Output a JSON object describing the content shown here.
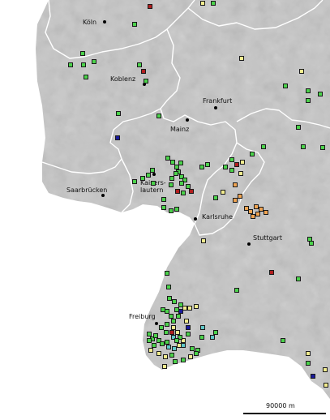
{
  "colors": {
    "land_fill": "#c9c9c9",
    "border": "#ffffff",
    "green": "#4bd24b",
    "yellow": "#f2ec8e",
    "orange": "#f0a452",
    "red": "#b21f1f",
    "blue": "#1a1a9c",
    "cyan": "#5fc7c7"
  },
  "cities": [
    {
      "name": "Köln"
    },
    {
      "name": "Koblenz"
    },
    {
      "name": "Frankfurt"
    },
    {
      "name": "Mainz"
    },
    {
      "name": "Saarbrücken"
    },
    {
      "name": "Kaisers-\nlautern"
    },
    {
      "name": "Karlsruhe"
    },
    {
      "name": "Stuttgart"
    },
    {
      "name": "Freiburg"
    }
  ],
  "scale_bar": {
    "label": "90000 m"
  }
}
